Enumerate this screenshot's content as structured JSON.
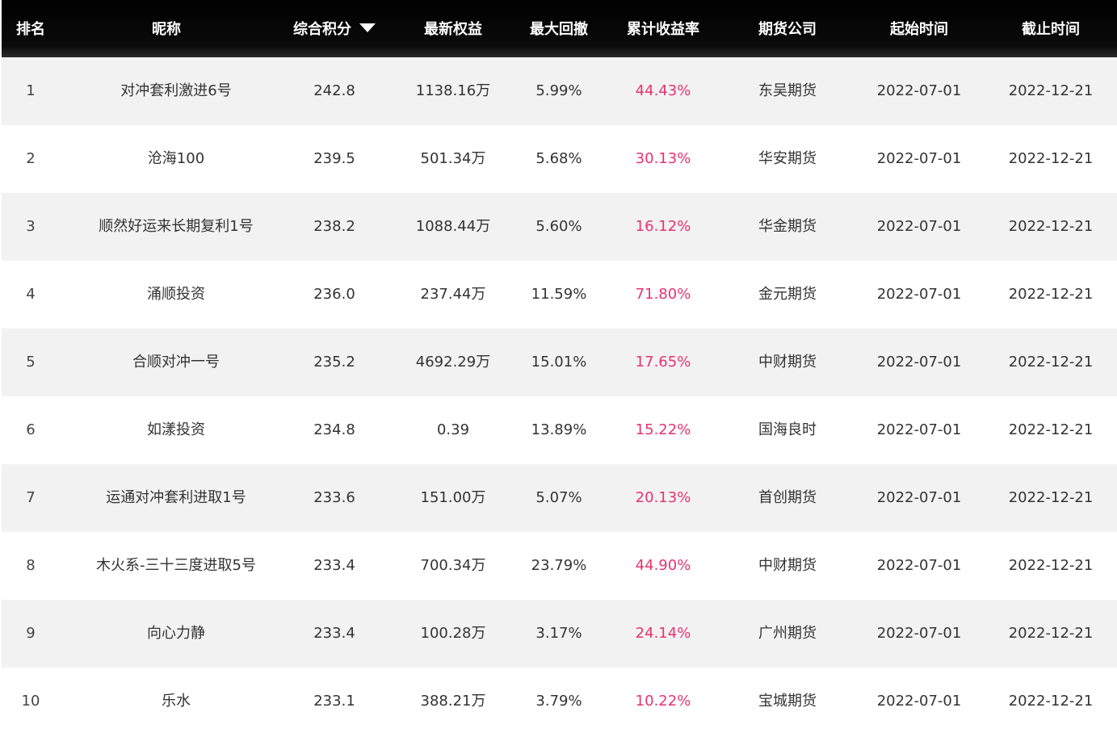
{
  "header": {
    "rank": "排名",
    "name": "昵称",
    "score": "综合积分",
    "equity": "最新权益",
    "drawdown": "最大回撤",
    "return": "累计收益率",
    "company": "期货公司",
    "start": "起始时间",
    "end": "截止时间"
  },
  "sort": {
    "column": "score",
    "direction": "descending",
    "icon": "caret-down-icon"
  },
  "colors": {
    "header_bg": "#000000",
    "header_text": "#ffffff",
    "row_alt_bg": "#f2f2f2",
    "row_bg": "#ffffff",
    "return_text": "#e8336e",
    "body_text": "#333333"
  },
  "rows": [
    {
      "rank": "1",
      "name": "对冲套利激进6号",
      "score": "242.8",
      "equity": "1138.16万",
      "drawdown": "5.99%",
      "return": "44.43%",
      "company": "东吴期货",
      "start": "2022-07-01",
      "end": "2022-12-21"
    },
    {
      "rank": "2",
      "name": "沧海100",
      "score": "239.5",
      "equity": "501.34万",
      "drawdown": "5.68%",
      "return": "30.13%",
      "company": "华安期货",
      "start": "2022-07-01",
      "end": "2022-12-21"
    },
    {
      "rank": "3",
      "name": "顺然好运来长期复利1号",
      "score": "238.2",
      "equity": "1088.44万",
      "drawdown": "5.60%",
      "return": "16.12%",
      "company": "华金期货",
      "start": "2022-07-01",
      "end": "2022-12-21"
    },
    {
      "rank": "4",
      "name": "涌顺投资",
      "score": "236.0",
      "equity": "237.44万",
      "drawdown": "11.59%",
      "return": "71.80%",
      "company": "金元期货",
      "start": "2022-07-01",
      "end": "2022-12-21"
    },
    {
      "rank": "5",
      "name": "合顺对冲一号",
      "score": "235.2",
      "equity": "4692.29万",
      "drawdown": "15.01%",
      "return": "17.65%",
      "company": "中财期货",
      "start": "2022-07-01",
      "end": "2022-12-21"
    },
    {
      "rank": "6",
      "name": "如漾投资",
      "score": "234.8",
      "equity": "0.39",
      "drawdown": "13.89%",
      "return": "15.22%",
      "company": "国海良时",
      "start": "2022-07-01",
      "end": "2022-12-21"
    },
    {
      "rank": "7",
      "name": "运通对冲套利进取1号",
      "score": "233.6",
      "equity": "151.00万",
      "drawdown": "5.07%",
      "return": "20.13%",
      "company": "首创期货",
      "start": "2022-07-01",
      "end": "2022-12-21"
    },
    {
      "rank": "8",
      "name": "木火系-三十三度进取5号",
      "score": "233.4",
      "equity": "700.34万",
      "drawdown": "23.79%",
      "return": "44.90%",
      "company": "中财期货",
      "start": "2022-07-01",
      "end": "2022-12-21"
    },
    {
      "rank": "9",
      "name": "向心力静",
      "score": "233.4",
      "equity": "100.28万",
      "drawdown": "3.17%",
      "return": "24.14%",
      "company": "广州期货",
      "start": "2022-07-01",
      "end": "2022-12-21"
    },
    {
      "rank": "10",
      "name": "乐水",
      "score": "233.1",
      "equity": "388.21万",
      "drawdown": "3.79%",
      "return": "10.22%",
      "company": "宝城期货",
      "start": "2022-07-01",
      "end": "2022-12-21"
    }
  ]
}
